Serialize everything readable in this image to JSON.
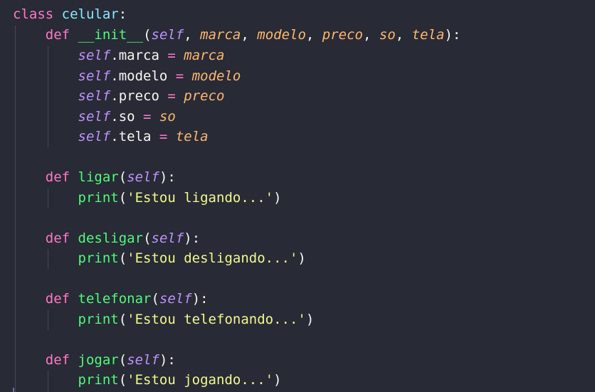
{
  "code": {
    "l1": {
      "kw": "class",
      "name": "celular",
      "colon": ":"
    },
    "l2": {
      "kw": "def",
      "name": "__init__",
      "open": "(",
      "self": "self",
      "p1": "marca",
      "p2": "modelo",
      "p3": "preco",
      "p4": "so",
      "p5": "tela",
      "close": "):",
      "comma": ", "
    },
    "l3": {
      "self": "self",
      "attr": ".marca",
      "eq": " = ",
      "val": "marca"
    },
    "l4": {
      "self": "self",
      "attr": ".modelo",
      "eq": " = ",
      "val": "modelo"
    },
    "l5": {
      "self": "self",
      "attr": ".preco",
      "eq": " = ",
      "val": "preco"
    },
    "l6": {
      "self": "self",
      "attr": ".so",
      "eq": " = ",
      "val": "so"
    },
    "l7": {
      "self": "self",
      "attr": ".tela",
      "eq": " = ",
      "val": "tela"
    },
    "m1": {
      "kw": "def",
      "name": "ligar",
      "open": "(",
      "self": "self",
      "close": "):",
      "call": "print",
      "copen": "(",
      "str": "'Estou ligando...'",
      "cclose": ")"
    },
    "m2": {
      "kw": "def",
      "name": "desligar",
      "open": "(",
      "self": "self",
      "close": "):",
      "call": "print",
      "copen": "(",
      "str": "'Estou desligando...'",
      "cclose": ")"
    },
    "m3": {
      "kw": "def",
      "name": "telefonar",
      "open": "(",
      "self": "self",
      "close": "):",
      "call": "print",
      "copen": "(",
      "str": "'Estou telefonando...'",
      "cclose": ")"
    },
    "m4": {
      "kw": "def",
      "name": "jogar",
      "open": "(",
      "self": "self",
      "close": "):",
      "call": "print",
      "copen": "(",
      "str": "'Estou jogando...'",
      "cclose": ")"
    }
  },
  "colors": {
    "background": "#282a36",
    "keyword": "#ff79c6",
    "class_name": "#8be9fd",
    "function": "#50fa7b",
    "self": "#bd93f9",
    "parameter": "#ffb86c",
    "string": "#f1fa8c",
    "text": "#f8f8f2"
  }
}
